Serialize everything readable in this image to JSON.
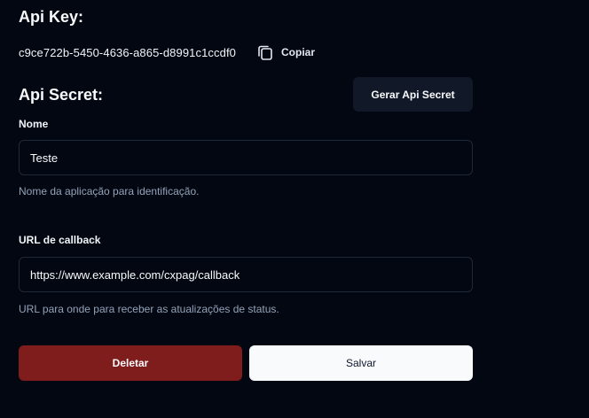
{
  "api_key": {
    "title": "Api Key:",
    "value": "c9ce722b-5450-4636-a865-d8991c1ccdf0",
    "copy_label": "Copiar",
    "copy_icon": "copy-icon"
  },
  "api_secret": {
    "title": "Api Secret:",
    "generate_label": "Gerar Api Secret"
  },
  "form": {
    "name": {
      "label": "Nome",
      "value": "Teste",
      "hint": "Nome da aplicação para identificação."
    },
    "callback": {
      "label": "URL de callback",
      "value": "https://www.example.com/cxpag/callback",
      "hint": "URL para onde para receber as atualizações de status."
    }
  },
  "actions": {
    "delete_label": "Deletar",
    "save_label": "Salvar"
  },
  "colors": {
    "background": "#030712",
    "delete_button": "#7f1d1d",
    "save_button": "#f8fafc",
    "secondary_button": "#111827",
    "input_border": "#1f2937",
    "hint_text": "#94a3b8"
  }
}
